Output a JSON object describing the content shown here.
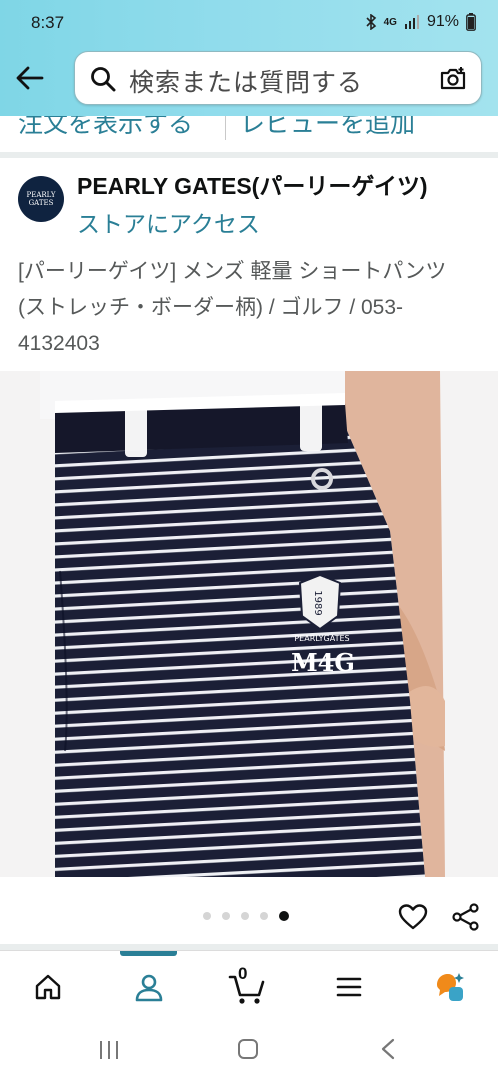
{
  "status_bar": {
    "time": "8:37",
    "battery": "91%",
    "network": "4G"
  },
  "search": {
    "placeholder": "検索または質問する"
  },
  "links": {
    "left": "注文を表示する",
    "right": "レビューを追加"
  },
  "brand": {
    "logo_text_line1": "PEARLY",
    "logo_text_line2": "GATES",
    "name": "PEARLY GATES(パーリーゲイツ)",
    "store_link": "ストアにアクセス"
  },
  "product": {
    "title": "[パーリーゲイツ] メンズ 軽量 ショートパンツ (ストレッチ・ボーダー柄) / ゴルフ / 053-4132403"
  },
  "image": {
    "emblem_year": "1989",
    "emblem_brand": "PEARLYGATES",
    "emblem_code": "M4G"
  },
  "carousel": {
    "count": 5,
    "active_index": 4
  },
  "bottom_nav": {
    "cart_count": "0",
    "active": "profile"
  },
  "colors": {
    "accent": "#2a7f96",
    "header_gradient": "#91dcec",
    "text": "#0f1111"
  }
}
